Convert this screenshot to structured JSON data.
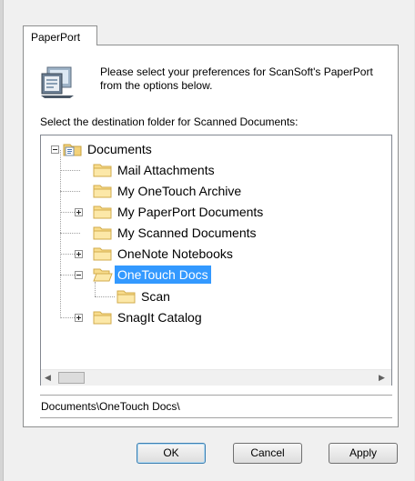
{
  "tab": {
    "label": "PaperPort"
  },
  "intro_text": "Please select your preferences for ScanSoft's PaperPort from the options below.",
  "destination_label": "Select the destination folder for Scanned Documents:",
  "tree": {
    "root": "Documents",
    "items": [
      {
        "label": "Mail Attachments"
      },
      {
        "label": "My OneTouch Archive"
      },
      {
        "label": "My PaperPort Documents"
      },
      {
        "label": "My Scanned Documents"
      },
      {
        "label": "OneNote Notebooks"
      },
      {
        "label": "OneTouch Docs"
      },
      {
        "label": "Scan"
      },
      {
        "label": "SnagIt Catalog"
      }
    ]
  },
  "path_value": "Documents\\OneTouch Docs\\",
  "buttons": {
    "ok": "OK",
    "cancel": "Cancel",
    "apply": "Apply"
  },
  "colors": {
    "selection": "#3399ff",
    "default_button_border": "#3c7fb1"
  }
}
